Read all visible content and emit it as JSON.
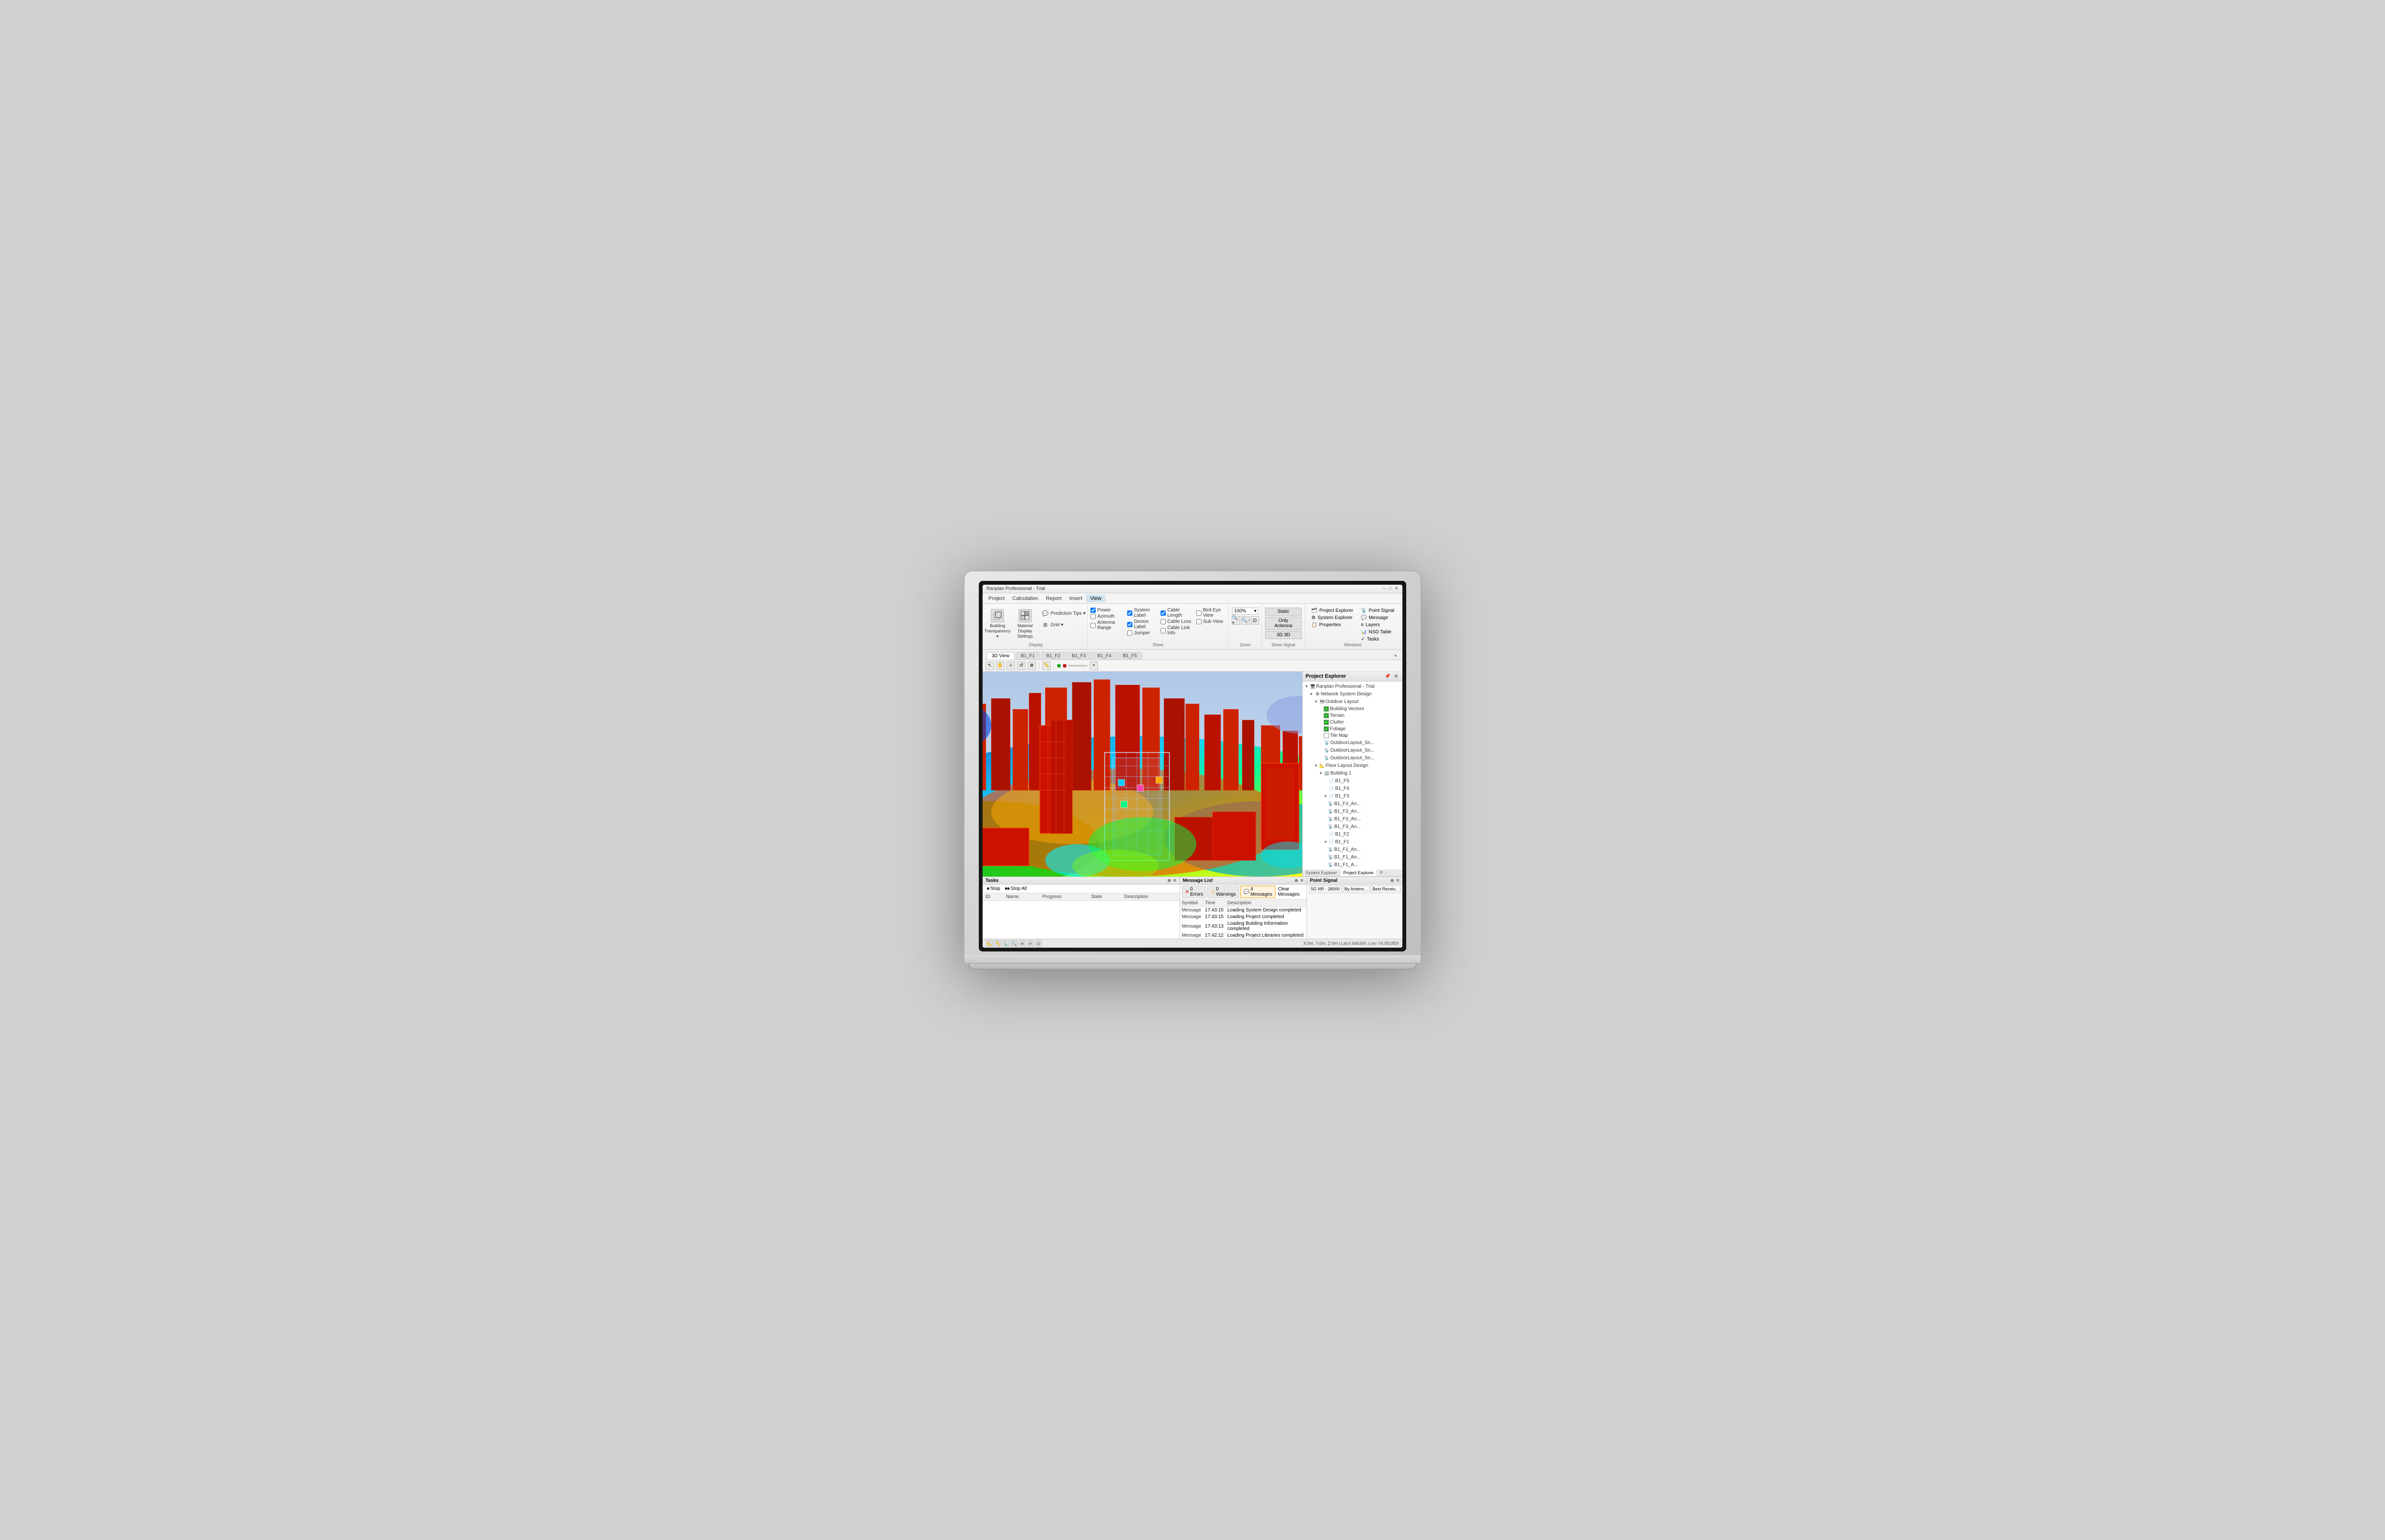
{
  "app": {
    "title": "Ranplan Professional - Trial",
    "window_controls": [
      "─",
      "□",
      "✕"
    ]
  },
  "menu": {
    "items": [
      "Project",
      "Calculation",
      "Report",
      "Insert",
      "View"
    ]
  },
  "ribbon": {
    "groups": [
      {
        "name": "Display",
        "buttons": [
          {
            "id": "building-transparency",
            "label": "Building\nTransparency",
            "icon": "□"
          },
          {
            "id": "material-display",
            "label": "Material Display\nSettings",
            "icon": "⊞"
          }
        ],
        "small_buttons": [
          {
            "id": "prediction-tips",
            "label": "Prediction\nTips",
            "icon": "💬",
            "has_dropdown": true
          },
          {
            "id": "grid",
            "label": "Grid",
            "icon": "⊞",
            "has_dropdown": true
          }
        ]
      },
      {
        "name": "Show",
        "checkboxes": [
          {
            "id": "power",
            "label": "Power",
            "checked": true
          },
          {
            "id": "azimuth",
            "label": "Azimuth",
            "checked": false
          },
          {
            "id": "antenna-range",
            "label": "Antenna Range",
            "checked": false
          },
          {
            "id": "system-label",
            "label": "System Label",
            "checked": true
          },
          {
            "id": "device-label",
            "label": "Device Label",
            "checked": true
          },
          {
            "id": "jumper",
            "label": "Jumper",
            "checked": false
          },
          {
            "id": "cable-length",
            "label": "Cable Length",
            "checked": true
          },
          {
            "id": "cable-loss",
            "label": "Cable Loss",
            "checked": false
          },
          {
            "id": "cable-link-info",
            "label": "Cable Link Info",
            "checked": false
          },
          {
            "id": "bird-eye-view",
            "label": "Bird Eye View",
            "checked": false
          },
          {
            "id": "sub-view",
            "label": "Sub View",
            "checked": false
          }
        ]
      },
      {
        "name": "Zoom",
        "zoom_value": "100%"
      },
      {
        "name": "Show Signal",
        "buttons": [
          {
            "id": "static",
            "label": "Static"
          },
          {
            "id": "only-antenna",
            "label": "Only Antenna"
          },
          {
            "id": "3d",
            "label": "3D 3D"
          }
        ]
      },
      {
        "name": "Windows",
        "items": [
          {
            "id": "project-explorer",
            "label": "Project Explorer",
            "icon": "🗂"
          },
          {
            "id": "system-explorer",
            "label": "System Explorer",
            "icon": "⚙"
          },
          {
            "id": "properties",
            "label": "Properties",
            "icon": "📋"
          },
          {
            "id": "point-signal",
            "label": "Point Signal",
            "icon": "📡"
          },
          {
            "id": "message",
            "label": "Message",
            "icon": "💬"
          },
          {
            "id": "layers",
            "label": "Layers",
            "icon": "≡"
          },
          {
            "id": "nsd-table",
            "label": "NSD Table",
            "icon": "📊"
          },
          {
            "id": "tasks",
            "label": "Tasks",
            "icon": "✓"
          }
        ]
      }
    ]
  },
  "tabs": {
    "items": [
      "3D View",
      "B1_F1",
      "B1_F2",
      "B1_F3",
      "B1_F4",
      "B1_F5"
    ],
    "active": "3D View"
  },
  "toolbar": {
    "items": [
      "⬡",
      "↩",
      "↪",
      "✂",
      "📋",
      "⊕",
      "⊖",
      "↺"
    ]
  },
  "project_explorer": {
    "title": "Project Explorer",
    "tree": [
      {
        "level": 0,
        "label": "Ranplan Professional - Trial",
        "icon": "🖥",
        "type": "root"
      },
      {
        "level": 1,
        "label": "Network System Design",
        "icon": "⚙",
        "type": "node",
        "expanded": true
      },
      {
        "level": 2,
        "label": "Outdoor Layout",
        "icon": "🗺",
        "type": "node",
        "expanded": true
      },
      {
        "level": 3,
        "label": "Building Vectors",
        "icon": "🏢",
        "type": "leaf",
        "checked": true
      },
      {
        "level": 3,
        "label": "Terrain",
        "icon": "⛰",
        "type": "leaf",
        "checked": true
      },
      {
        "level": 3,
        "label": "Clutter",
        "icon": "🔲",
        "type": "leaf",
        "checked": true
      },
      {
        "level": 3,
        "label": "Foliage",
        "icon": "🌿",
        "type": "leaf",
        "checked": true
      },
      {
        "level": 3,
        "label": "Tile Map",
        "icon": "🗺",
        "type": "leaf",
        "checked": false
      },
      {
        "level": 3,
        "label": "OutdoorLayout_Sn...",
        "icon": "📡",
        "type": "leaf"
      },
      {
        "level": 3,
        "label": "OutdoorLayout_Sn...",
        "icon": "📡",
        "type": "leaf"
      },
      {
        "level": 3,
        "label": "OutdoorLayout_Sn...",
        "icon": "📡",
        "type": "leaf"
      },
      {
        "level": 2,
        "label": "Floor Layout Design",
        "icon": "📐",
        "type": "node",
        "expanded": true
      },
      {
        "level": 3,
        "label": "Building 1",
        "icon": "🏢",
        "type": "node",
        "expanded": true
      },
      {
        "level": 4,
        "label": "B1_F5",
        "icon": "📄",
        "type": "leaf"
      },
      {
        "level": 4,
        "label": "B1_F4",
        "icon": "📄",
        "type": "leaf"
      },
      {
        "level": 4,
        "label": "B1_F3",
        "icon": "📄",
        "type": "node",
        "expanded": true
      },
      {
        "level": 5,
        "label": "B1_F3_An...",
        "icon": "📡",
        "type": "leaf"
      },
      {
        "level": 5,
        "label": "B1_F3_An...",
        "icon": "📡",
        "type": "leaf"
      },
      {
        "level": 5,
        "label": "B1_F3_An...",
        "icon": "📡",
        "type": "leaf"
      },
      {
        "level": 5,
        "label": "B1_F3_An...",
        "icon": "📡",
        "type": "leaf"
      },
      {
        "level": 4,
        "label": "B1_F2",
        "icon": "📄",
        "type": "leaf"
      },
      {
        "level": 4,
        "label": "B1_F1",
        "icon": "📄",
        "type": "node",
        "expanded": true
      },
      {
        "level": 5,
        "label": "B1_F1_An...",
        "icon": "📡",
        "type": "leaf"
      },
      {
        "level": 5,
        "label": "B1_F1_An...",
        "icon": "📡",
        "type": "leaf"
      },
      {
        "level": 5,
        "label": "B1_F1_A...",
        "icon": "📡",
        "type": "leaf"
      }
    ]
  },
  "tasks": {
    "title": "Tasks",
    "columns": [
      "ID",
      "Name",
      "Progress",
      "State",
      "Description"
    ],
    "rows": [],
    "toolbar": [
      "Stop",
      "Stop All"
    ]
  },
  "messages": {
    "title": "Message List",
    "tabs": [
      {
        "id": "errors",
        "label": "0 Errors",
        "icon": "✕"
      },
      {
        "id": "warnings",
        "label": "0 Warnings",
        "icon": "⚠"
      },
      {
        "id": "messages",
        "label": "4 Messages",
        "icon": "💬",
        "active": true
      }
    ],
    "clear_btn": "Clear Messages",
    "columns": [
      "Symbol",
      "Time",
      "Description"
    ],
    "rows": [
      {
        "type": "Message",
        "time": "17:43:15",
        "description": "Loading System Design completed"
      },
      {
        "type": "Message",
        "time": "17:43:15",
        "description": "Loading Project completed"
      },
      {
        "type": "Message",
        "time": "17:43:13",
        "description": "Loading Building Information completed"
      },
      {
        "type": "Message",
        "time": "17:42:12",
        "description": "Loading Project Libraries completed"
      }
    ]
  },
  "point_signal": {
    "title": "Point Signal",
    "network": "5G NR - 28000",
    "mode": "By Antenn...",
    "view": "Best Receiv..."
  },
  "status_bar": {
    "coordinates": "X:0m, Y:0m, Z:0m | Lat:4.666269, Lon:-74.051859"
  },
  "panel_tabs": {
    "bottom_left": [
      "System Explorer",
      "Project Explorer"
    ],
    "bottom_right": [
      "P"
    ]
  },
  "colors": {
    "accent_blue": "#1565c0",
    "tree_green": "#22aa22",
    "error_red": "#cc0000",
    "warning_orange": "#f0a000",
    "ribbon_bg": "#f5f5f5"
  }
}
